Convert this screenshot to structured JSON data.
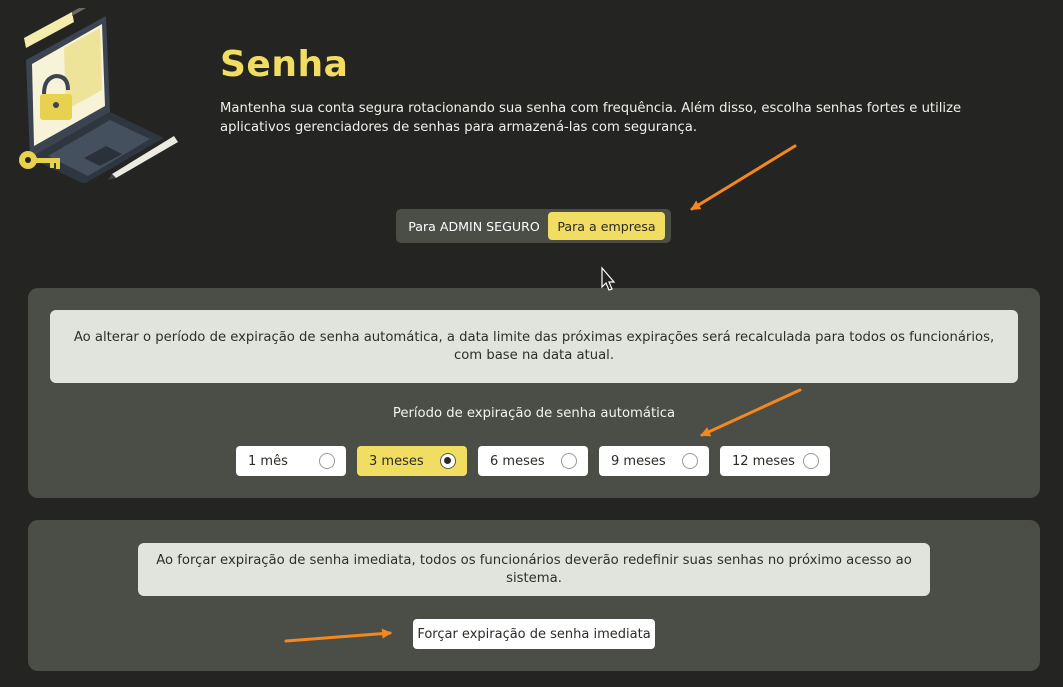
{
  "header": {
    "title": "Senha",
    "description": "Mantenha sua conta segura rotacionando sua senha com frequência. Além disso, escolha senhas fortes e utilize aplicativos gerenciadores de senhas para armazená-las com segurança."
  },
  "scope_toggle": {
    "options": [
      {
        "label": "Para ADMIN SEGURO",
        "selected": false
      },
      {
        "label": "Para a empresa",
        "selected": true
      }
    ]
  },
  "expiration_panel": {
    "notice": "Ao alterar o período de expiração de senha automática, a data limite das próximas expirações será recalculada para todos os funcionários, com base na data atual.",
    "label": "Período de expiração de senha automática",
    "options": [
      {
        "label": "1 mês",
        "selected": false
      },
      {
        "label": "3 meses",
        "selected": true
      },
      {
        "label": "6 meses",
        "selected": false
      },
      {
        "label": "9 meses",
        "selected": false
      },
      {
        "label": "12 meses",
        "selected": false
      }
    ]
  },
  "force_panel": {
    "notice": "Ao forçar expiração de senha imediata, todos os funcionários deverão redefinir suas senhas no próximo acesso ao sistema.",
    "button_label": "Forçar expiração de senha imediata"
  },
  "colors": {
    "background": "#242522",
    "panel": "#4b4d47",
    "accent": "#f2dd63",
    "annotation_arrow": "#f5871f"
  },
  "icons": [
    "laptop-lock-illustration",
    "key-icon",
    "pen-icon",
    "cursor-icon",
    "annotation-arrow"
  ]
}
